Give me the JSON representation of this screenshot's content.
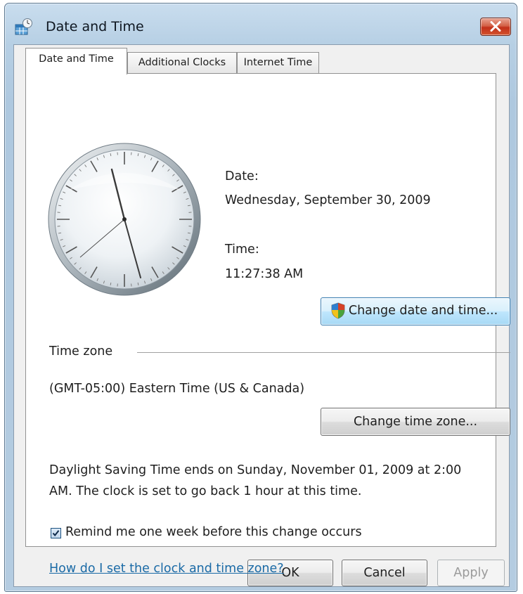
{
  "window": {
    "title": "Date and Time"
  },
  "tabs": [
    {
      "label": "Date and Time",
      "active": true
    },
    {
      "label": "Additional Clocks",
      "active": false
    },
    {
      "label": "Internet Time",
      "active": false
    }
  ],
  "datetime": {
    "date_label": "Date:",
    "date_value": "Wednesday, September 30, 2009",
    "time_label": "Time:",
    "time_value": "11:27:38 AM",
    "change_button": "Change date and time..."
  },
  "timezone": {
    "section_label": "Time zone",
    "value": "(GMT-05:00) Eastern Time (US & Canada)",
    "change_button": "Change time zone..."
  },
  "dst": {
    "line1": "Daylight Saving Time ends on Sunday, November 01, 2009 at 2:00",
    "line2": "AM. The clock is set to go back 1 hour at this time.",
    "remind_label": "Remind me one week before this change occurs",
    "remind_checked": true
  },
  "help_link": "How do I set the clock and time zone?",
  "dialog_buttons": {
    "ok": "OK",
    "cancel": "Cancel",
    "apply": "Apply",
    "apply_enabled": false
  },
  "colors": {
    "link": "#1a6aa6",
    "close_button": "#c2301a",
    "focus_border": "#3c7fb1"
  },
  "icons": {
    "app": "date-time-icon",
    "close": "close-x-icon",
    "shield": "uac-shield-icon",
    "check": "checkmark-icon"
  }
}
